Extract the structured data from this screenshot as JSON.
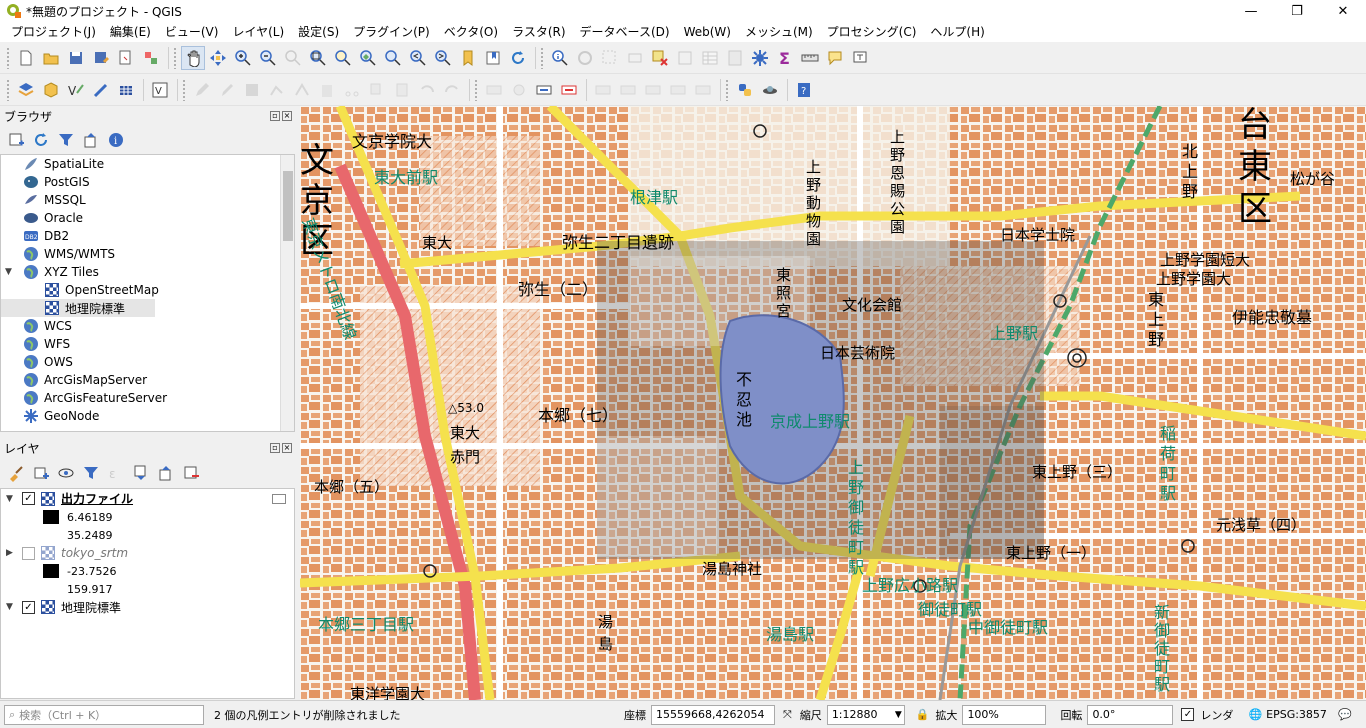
{
  "window": {
    "title": "*無題のプロジェクト - QGIS",
    "minimize": "—",
    "maximize": "❐",
    "close": "✕"
  },
  "menu": [
    "プロジェクト(J)",
    "編集(E)",
    "ビュー(V)",
    "レイヤ(L)",
    "設定(S)",
    "プラグイン(P)",
    "ベクタ(O)",
    "ラスタ(R)",
    "データベース(D)",
    "Web(W)",
    "メッシュ(M)",
    "プロセシング(C)",
    "ヘルプ(H)"
  ],
  "browser": {
    "title": "ブラウザ",
    "items": [
      {
        "label": "SpatiaLite",
        "icon": "feather-icon"
      },
      {
        "label": "PostGIS",
        "icon": "elephant-icon"
      },
      {
        "label": "MSSQL",
        "icon": "mssql-icon"
      },
      {
        "label": "Oracle",
        "icon": "oracle-icon"
      },
      {
        "label": "DB2",
        "icon": "db2-icon"
      },
      {
        "label": "WMS/WMTS",
        "icon": "globe-icon"
      },
      {
        "label": "XYZ Tiles",
        "icon": "globe-icon"
      },
      {
        "label": "OpenStreetMap",
        "icon": "tile-icon"
      },
      {
        "label": "地理院標準",
        "icon": "tile-icon"
      },
      {
        "label": "WCS",
        "icon": "globe-icon"
      },
      {
        "label": "WFS",
        "icon": "globe-icon"
      },
      {
        "label": "OWS",
        "icon": "globe-icon"
      },
      {
        "label": "ArcGisMapServer",
        "icon": "globe-icon"
      },
      {
        "label": "ArcGisFeatureServer",
        "icon": "globe-icon"
      },
      {
        "label": "GeoNode",
        "icon": "geonode-icon"
      }
    ]
  },
  "layers": {
    "title": "レイヤ",
    "items": [
      {
        "name": "出力ファイル",
        "checked": true,
        "min": "6.46189",
        "max": "35.2489"
      },
      {
        "name": "tokyo_srtm",
        "checked": false,
        "min": "-23.7526",
        "max": "159.917"
      },
      {
        "name": "地理院標準",
        "checked": true
      }
    ]
  },
  "map": {
    "labels": [
      {
        "t": "文京区",
        "kind": "ward"
      },
      {
        "t": "台東区",
        "kind": "ward"
      },
      {
        "t": "文京学院大"
      },
      {
        "t": "東大前駅",
        "kind": "station"
      },
      {
        "t": "東京メトロ南北線",
        "kind": "station"
      },
      {
        "t": "東大"
      },
      {
        "t": "弥生二丁目遺跡"
      },
      {
        "t": "弥生（二）"
      },
      {
        "t": "根津駅",
        "kind": "station"
      },
      {
        "t": "上野恩賜公園"
      },
      {
        "t": "上野動物園"
      },
      {
        "t": "東照宮"
      },
      {
        "t": "文化会館"
      },
      {
        "t": "日本芸術院"
      },
      {
        "t": "日本学士院"
      },
      {
        "t": "不忍池"
      },
      {
        "t": "京成上野駅",
        "kind": "station"
      },
      {
        "t": "上野駅",
        "kind": "station"
      },
      {
        "t": "本郷（七）"
      },
      {
        "t": "東大赤門"
      },
      {
        "t": "本郷（五）"
      },
      {
        "t": "湯島神社"
      },
      {
        "t": "湯島"
      },
      {
        "t": "湯島駅",
        "kind": "station"
      },
      {
        "t": "上野広小路駅",
        "kind": "station"
      },
      {
        "t": "御徒町駅",
        "kind": "station"
      },
      {
        "t": "中御徒町駅",
        "kind": "station"
      },
      {
        "t": "新御徒町駅",
        "kind": "station"
      },
      {
        "t": "本郷三丁目駅",
        "kind": "station"
      },
      {
        "t": "東洋学園大"
      },
      {
        "t": "上野学園短大"
      },
      {
        "t": "上野学園大"
      },
      {
        "t": "伊能忠敬墓"
      },
      {
        "t": "松が谷"
      },
      {
        "t": "東上野（三）"
      },
      {
        "t": "東上野（一）"
      },
      {
        "t": "元浅草（四）"
      },
      {
        "t": "稲荷町駅",
        "kind": "station"
      },
      {
        "t": "上野御徒町駅",
        "kind": "station"
      },
      {
        "t": "△53.0"
      },
      {
        "t": "北上野"
      },
      {
        "t": "東上野"
      }
    ]
  },
  "status": {
    "search_placeholder": "検索（Ctrl + K）",
    "message": "2 個の凡例エントリが削除されました",
    "coord_label": "座標",
    "coord_value": "15559668,4262054",
    "scale_label": "縮尺",
    "scale_value": "1:12880",
    "magnify_label": "拡大",
    "magnify_value": "100%",
    "rotate_label": "回転",
    "rotate_value": "0.0°",
    "render_label": "レンダ",
    "crs": "EPSG:3857"
  },
  "colors": {
    "building": "#e9a070",
    "road_main": "#f5e14d",
    "rail": "#e8686c",
    "station": "#0f8a6d",
    "overlay": "#555555",
    "pond": "#7f8fc8"
  }
}
